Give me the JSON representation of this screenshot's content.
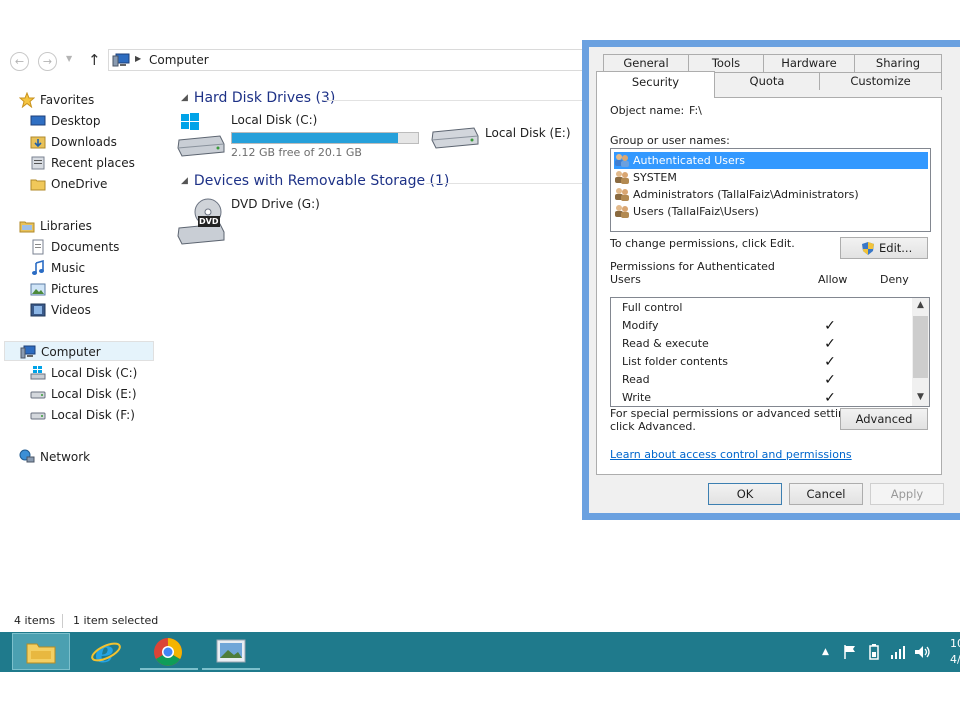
{
  "explorer": {
    "address": {
      "path": "Computer"
    },
    "nav": {
      "favorites": "Favorites",
      "desktop": "Desktop",
      "downloads": "Downloads",
      "recent": "Recent places",
      "onedrive": "OneDrive",
      "libraries": "Libraries",
      "documents": "Documents",
      "music": "Music",
      "pictures": "Pictures",
      "videos": "Videos",
      "computer": "Computer",
      "disk_c": "Local Disk (C:)",
      "disk_e": "Local Disk (E:)",
      "disk_f": "Local Disk (F:)",
      "network": "Network"
    },
    "groups": {
      "hdd": "Hard Disk Drives (3)",
      "removable": "Devices with Removable Storage (1)"
    },
    "drives": {
      "c": {
        "name": "Local Disk (C:)",
        "free": "2.12 GB free of 20.1 GB",
        "used_fraction": 0.895
      },
      "e": {
        "name": "Local Disk (E:)"
      },
      "g": {
        "name": "DVD Drive (G:)",
        "badge": "DVD"
      }
    },
    "status": {
      "count": "4 items",
      "selected": "1 item selected"
    }
  },
  "dialog": {
    "tabs_row1": [
      "General",
      "Tools",
      "Hardware",
      "Sharing"
    ],
    "tabs_row2": [
      "Security",
      "Quota",
      "Customize"
    ],
    "object_label": "Object name:",
    "object_value": "F:\\",
    "group_label": "Group or user names:",
    "users": [
      "Authenticated Users",
      "SYSTEM",
      "Administrators (TallalFaiz\\Administrators)",
      "Users (TallalFaiz\\Users)"
    ],
    "change_text": "To change permissions, click Edit.",
    "edit_button": "Edit...",
    "perm_label_line1": "Permissions for Authenticated",
    "perm_label_line2": "Users",
    "allow_header": "Allow",
    "deny_header": "Deny",
    "permissions": [
      {
        "name": "Full control",
        "allow": ""
      },
      {
        "name": "Modify",
        "allow": "✓"
      },
      {
        "name": "Read & execute",
        "allow": "✓"
      },
      {
        "name": "List folder contents",
        "allow": "✓"
      },
      {
        "name": "Read",
        "allow": "✓"
      },
      {
        "name": "Write",
        "allow": "✓"
      }
    ],
    "special_line1": "For special permissions or advanced settings,",
    "special_line2": "click Advanced.",
    "advanced_button": "Advanced",
    "learn_link": "Learn about access control and permissions",
    "ok_button": "OK",
    "cancel_button": "Cancel",
    "apply_button": "Apply"
  },
  "taskbar": {
    "clock_line1": "10",
    "clock_line2": "4/"
  }
}
